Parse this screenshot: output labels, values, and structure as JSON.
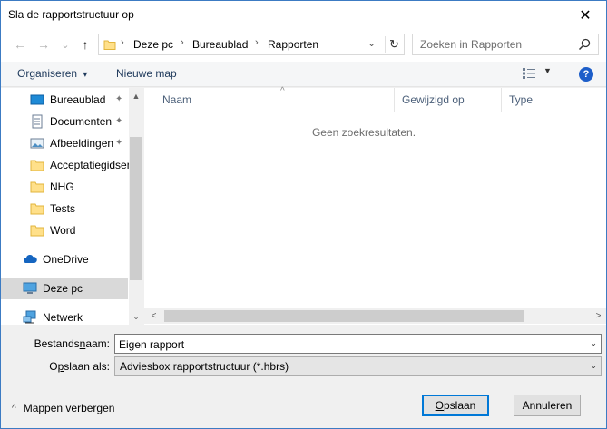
{
  "window": {
    "title": "Sla de rapportstructuur op",
    "close_glyph": "✕"
  },
  "nav": {
    "back_glyph": "←",
    "forward_glyph": "→",
    "recent_glyph": "⌄",
    "up_glyph": "↑",
    "breadcrumbs": [
      "Deze pc",
      "Bureaublad",
      "Rapporten"
    ],
    "separator_glyph": "›",
    "dropdown_glyph": "⌄",
    "refresh_glyph": "↻",
    "search_placeholder": "Zoeken in Rapporten"
  },
  "toolbar": {
    "organize_label": "Organiseren",
    "organize_glyph": "▾",
    "new_folder_label": "Nieuwe map",
    "view_drop_glyph": "▼",
    "help_glyph": "?"
  },
  "navpane": {
    "items": [
      {
        "label": "Bureaublad",
        "icon": "desktop-icon",
        "pinned": true
      },
      {
        "label": "Documenten",
        "icon": "documents-icon",
        "pinned": true
      },
      {
        "label": "Afbeeldingen",
        "icon": "pictures-icon",
        "pinned": true
      },
      {
        "label": "Acceptatiegidsen",
        "icon": "folder-icon",
        "pinned": false
      },
      {
        "label": "NHG",
        "icon": "folder-icon",
        "pinned": false
      },
      {
        "label": "Tests",
        "icon": "folder-icon",
        "pinned": false
      },
      {
        "label": "Word",
        "icon": "folder-icon",
        "pinned": false
      },
      {
        "label": "OneDrive",
        "icon": "onedrive-icon",
        "pinned": false
      },
      {
        "label": "Deze pc",
        "icon": "pc-icon",
        "pinned": false
      },
      {
        "label": "Netwerk",
        "icon": "network-icon",
        "pinned": false
      }
    ],
    "pin_glyph": "📌",
    "scroll_up_glyph": "▲",
    "scroll_down_glyph": "⌄"
  },
  "filelist": {
    "columns": [
      "Naam",
      "Gewijzigd op",
      "Type"
    ],
    "sort_glyph": "^",
    "empty_message": "Geen zoekresultaten.",
    "scroll_left_glyph": "<",
    "scroll_right_glyph": ">"
  },
  "form": {
    "filename_label_pre": "Bestands",
    "filename_label_ul": "n",
    "filename_label_post": "aam:",
    "filename_value": "Eigen rapport",
    "filetype_label_pre": "O",
    "filetype_label_ul": "p",
    "filetype_label_post": "slaan als:",
    "filetype_value": "Adviesbox rapportstructuur (*.hbrs)",
    "dropdown_glyph": "⌄"
  },
  "footer": {
    "hide_folders_glyph": "^",
    "hide_folders_label": "Mappen verbergen",
    "save_label_ul": "O",
    "save_label_rest": "pslaan",
    "cancel_label": "Annuleren"
  }
}
